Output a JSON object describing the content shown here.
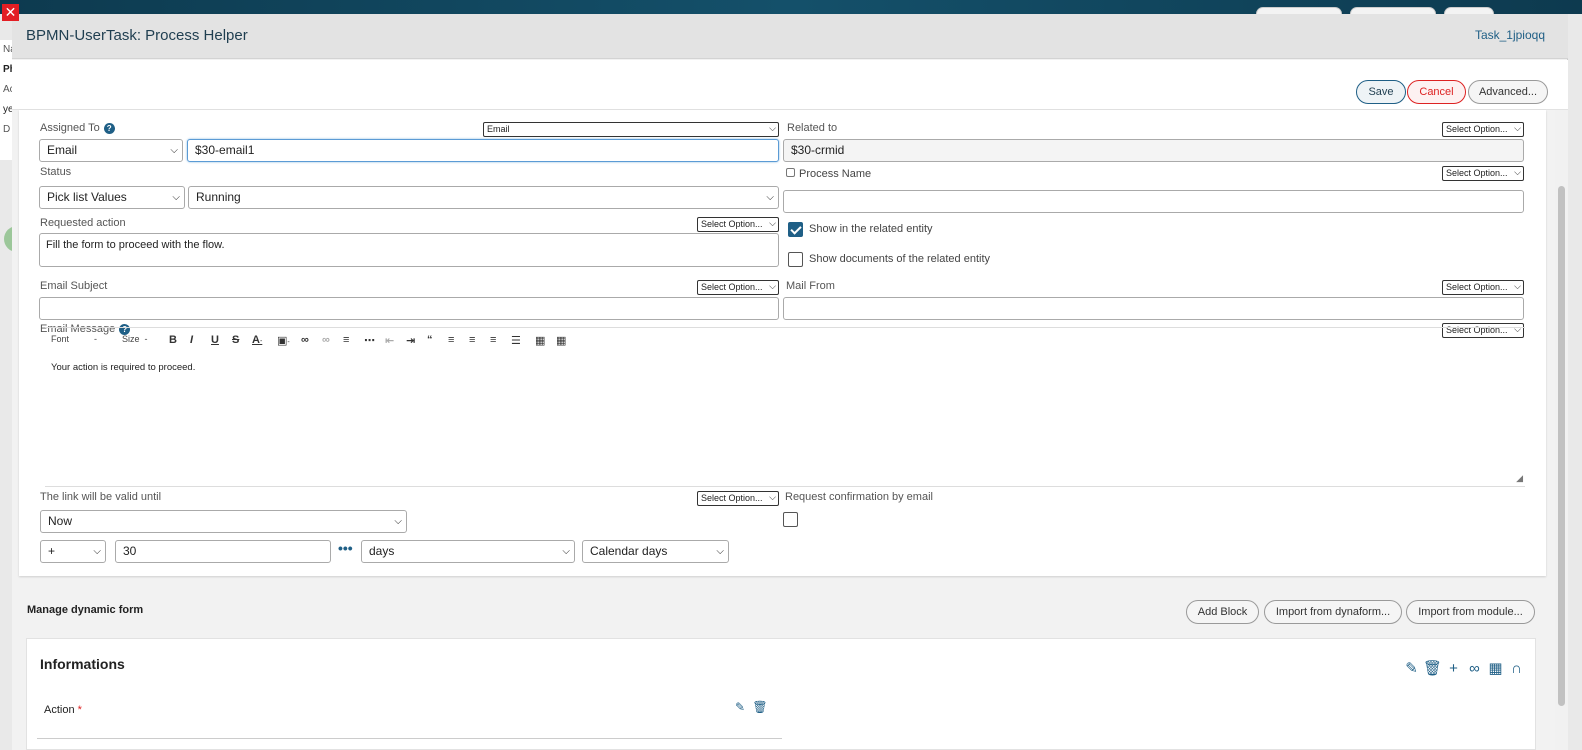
{
  "background": {
    "side_labels": [
      "Na",
      "Ph",
      "Ac",
      "ye",
      "D"
    ]
  },
  "dialog": {
    "title": "BPMN-UserTask: Process Helper",
    "task_id": "Task_1jpioqq",
    "buttons": {
      "save": "Save",
      "cancel": "Cancel",
      "advanced": "Advanced..."
    }
  },
  "form": {
    "assigned_to": {
      "label": "Assigned To",
      "mode_select": "Email",
      "type_select": "Email",
      "value": "$30-email1"
    },
    "related_to": {
      "label": "Related to",
      "option_select": "Select Option...",
      "value": "$30-crmid"
    },
    "status": {
      "label": "Status",
      "source_select": "Pick list Values",
      "value_select": "Running"
    },
    "process_name": {
      "label": "Process Name",
      "option_select": "Select Option...",
      "value": ""
    },
    "requested_action": {
      "label": "Requested action",
      "option_select": "Select Option...",
      "value": "Fill the form to proceed with the flow."
    },
    "show_in_related": {
      "label": "Show in the related entity",
      "checked": true
    },
    "show_documents": {
      "label": "Show documents of the related entity",
      "checked": false
    },
    "email_subject": {
      "label": "Email Subject",
      "option_select": "Select Option...",
      "value": ""
    },
    "mail_from": {
      "label": "Mail From",
      "option_select": "Select Option...",
      "value": ""
    },
    "email_message": {
      "label": "Email Message",
      "option_select": "Select Option...",
      "toolbar": {
        "font": "Font",
        "size": "Size"
      },
      "body": "Your action is required to proceed."
    },
    "link_valid": {
      "label": "The link will be valid until",
      "option_select": "Select Option...",
      "base": "Now",
      "operator": "+",
      "amount": "30",
      "unit": "days",
      "calendar": "Calendar days"
    },
    "request_confirmation": {
      "label": "Request confirmation by email",
      "checked": false
    }
  },
  "dynamic_form": {
    "title": "Manage dynamic form",
    "buttons": {
      "add_block": "Add Block",
      "import_dynaform": "Import from dynaform...",
      "import_module": "Import from module..."
    },
    "block": {
      "title": "Informations",
      "fields": [
        {
          "label": "Action",
          "required": true
        }
      ]
    }
  },
  "colors": {
    "accent": "#1f5f86",
    "danger": "#dd2222",
    "header_bg": "#e3e3e3"
  }
}
